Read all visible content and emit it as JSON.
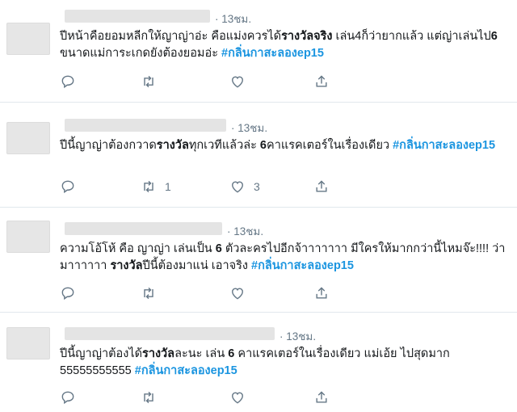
{
  "tweets": [
    {
      "time": "13ชม.",
      "parts": [
        {
          "t": "ปีหน้าคือยอมหลีกให้ญาญ่าอ่ะ คือแม่งควรได้"
        },
        {
          "t": "รางวัลจริง",
          "s": "b"
        },
        {
          "t": " เล่น4ก็ว่ายากแล้ว แต่ญ่าเล่นไป"
        },
        {
          "t": "6",
          "s": "b"
        },
        {
          "t": " ขนาดแม่การะเกดยังต้องยอมอ่ะ "
        },
        {
          "t": "#กลิ่นกาสะลองep15",
          "s": "tag"
        }
      ],
      "reply_count": "",
      "retweet_count": "",
      "like_count": ""
    },
    {
      "time": "13ชม.",
      "parts": [
        {
          "t": "ปีนี้ญาญ่าต้องกวาด"
        },
        {
          "t": "รางวัล",
          "s": "b"
        },
        {
          "t": "ทุกเวทีแล้วล่ะ "
        },
        {
          "t": "6",
          "s": "b"
        },
        {
          "t": "คาแรคเตอร์ในเรื่องเดียว  "
        },
        {
          "t": "#กลิ่นกาสะลองep15",
          "s": "tag"
        }
      ],
      "reply_count": "",
      "retweet_count": "1",
      "like_count": "3"
    },
    {
      "time": "13ชม.",
      "parts": [
        {
          "t": "ความโอ้โห้ คือ ญาญ่า เล่นเป็น "
        },
        {
          "t": "6",
          "s": "b"
        },
        {
          "t": " ตัวละครไปอีกจ้าาาาาาา มีใครให้มากกว่านี้ไหมจ๊ะ!!!! ว่ามาาาาาา "
        },
        {
          "t": "รางวัล",
          "s": "b"
        },
        {
          "t": "ปีนี้ต้องมาแน่ เอาจริง "
        },
        {
          "t": "#กลิ่นกาสะลองep15",
          "s": "tag"
        }
      ],
      "reply_count": "",
      "retweet_count": "",
      "like_count": ""
    },
    {
      "time": "13ชม.",
      "parts": [
        {
          "t": "ปีนี้ญาญ่าต้องได้"
        },
        {
          "t": "รางวัล",
          "s": "b"
        },
        {
          "t": "ละนะ เล่น "
        },
        {
          "t": "6",
          "s": "b"
        },
        {
          "t": " คาแรคเตอร์ในเรื่องเดียว แม่เอ้ย ไปสุดมาก 55555555555 "
        },
        {
          "t": "#กลิ่นกาสะลองep15",
          "s": "tag"
        }
      ],
      "reply_count": "",
      "retweet_count": "",
      "like_count": ""
    }
  ],
  "icons": {
    "reply": "reply-icon",
    "retweet": "retweet-icon",
    "like": "heart-icon",
    "share": "share-icon"
  },
  "colors": {
    "text": "#14171a",
    "muted": "#657786",
    "hashtag": "#1b95e0",
    "divider": "#e1e8ed"
  }
}
